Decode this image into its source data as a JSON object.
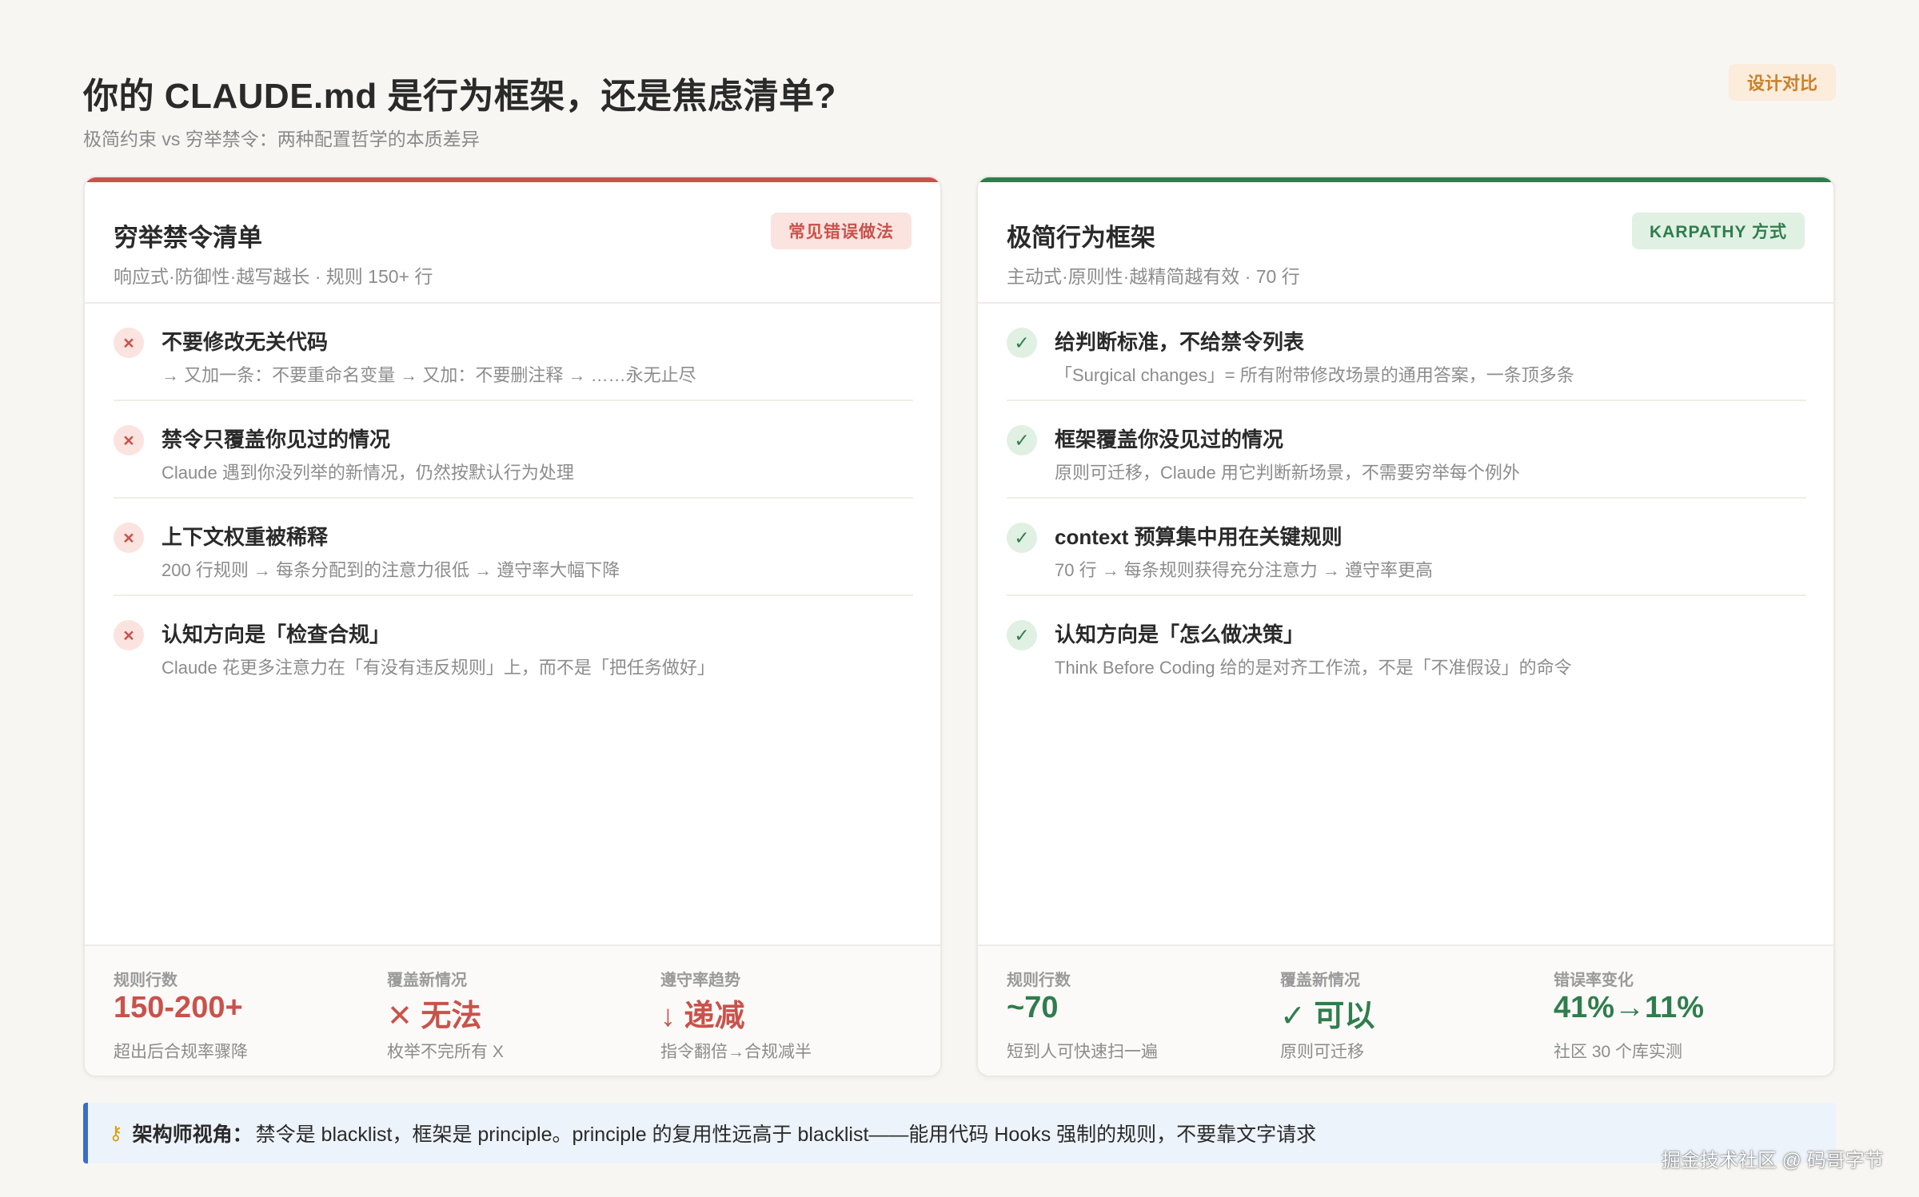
{
  "header": {
    "title": "你的 CLAUDE.md 是行为框架，还是焦虑清单?",
    "subtitle": "极简约束 vs 穷举禁令：两种配置哲学的本质差异",
    "badge": "设计对比"
  },
  "left_card": {
    "title": "穷举禁令清单",
    "subtitle": "响应式·防御性·越写越长 · 规则 150+ 行",
    "badge": "常见错误做法",
    "mark_icon": "x-icon",
    "mark_glyph": "×",
    "items": [
      {
        "title": "不要修改无关代码",
        "desc": "→ 又加一条：不要重命名变量 → 又加：不要删注释 → ……永无止尽"
      },
      {
        "title": "禁令只覆盖你见过的情况",
        "desc": "Claude 遇到你没列举的新情况，仍然按默认行为处理"
      },
      {
        "title": "上下文权重被稀释",
        "desc": "200 行规则 → 每条分配到的注意力很低 → 遵守率大幅下降"
      },
      {
        "title": "认知方向是「检查合规」",
        "desc": "Claude 花更多注意力在「有没有违反规则」上，而不是「把任务做好」"
      }
    ],
    "stats": [
      {
        "label": "规则行数",
        "value": "150-200+",
        "note": "超出后合规率骤降"
      },
      {
        "label": "覆盖新情况",
        "value": "✕ 无法",
        "note": "枚举不完所有 X"
      },
      {
        "label": "遵守率趋势",
        "value": "↓ 递减",
        "note": "指令翻倍→合规减半"
      }
    ]
  },
  "right_card": {
    "title": "极简行为框架",
    "subtitle": "主动式·原则性·越精简越有效 · 70 行",
    "badge": "KARPATHY 方式",
    "mark_icon": "check-icon",
    "mark_glyph": "✓",
    "items": [
      {
        "title": "给判断标准，不给禁令列表",
        "desc": "「Surgical changes」= 所有附带修改场景的通用答案，一条顶多条"
      },
      {
        "title": "框架覆盖你没见过的情况",
        "desc": "原则可迁移，Claude 用它判断新场景，不需要穷举每个例外"
      },
      {
        "title": "context 预算集中用在关键规则",
        "desc": "70 行 → 每条规则获得充分注意力 → 遵守率更高"
      },
      {
        "title": "认知方向是「怎么做决策」",
        "desc": "Think Before Coding 给的是对齐工作流，不是「不准假设」的命令"
      }
    ],
    "stats": [
      {
        "label": "规则行数",
        "value": "~70",
        "note": "短到人可快速扫一遍"
      },
      {
        "label": "覆盖新情况",
        "value": "✓ 可以",
        "note": "原则可迁移"
      },
      {
        "label": "错误率变化",
        "value": "41%→11%",
        "note": "社区 30 个库实测"
      }
    ]
  },
  "callout": {
    "icon": "key-icon",
    "label": "架构师视角：",
    "text": "禁令是 blacklist，框架是 principle。principle 的复用性远高于 blacklist——能用代码 Hooks 强制的规则，不要靠文字请求"
  },
  "watermark": "掘金技术社区 @ 码哥字节",
  "colors": {
    "accent_bad": "#c9524b",
    "accent_good": "#2f7d4d",
    "callout_border": "#3a6fc4",
    "badge_orange": "#c9812c"
  }
}
